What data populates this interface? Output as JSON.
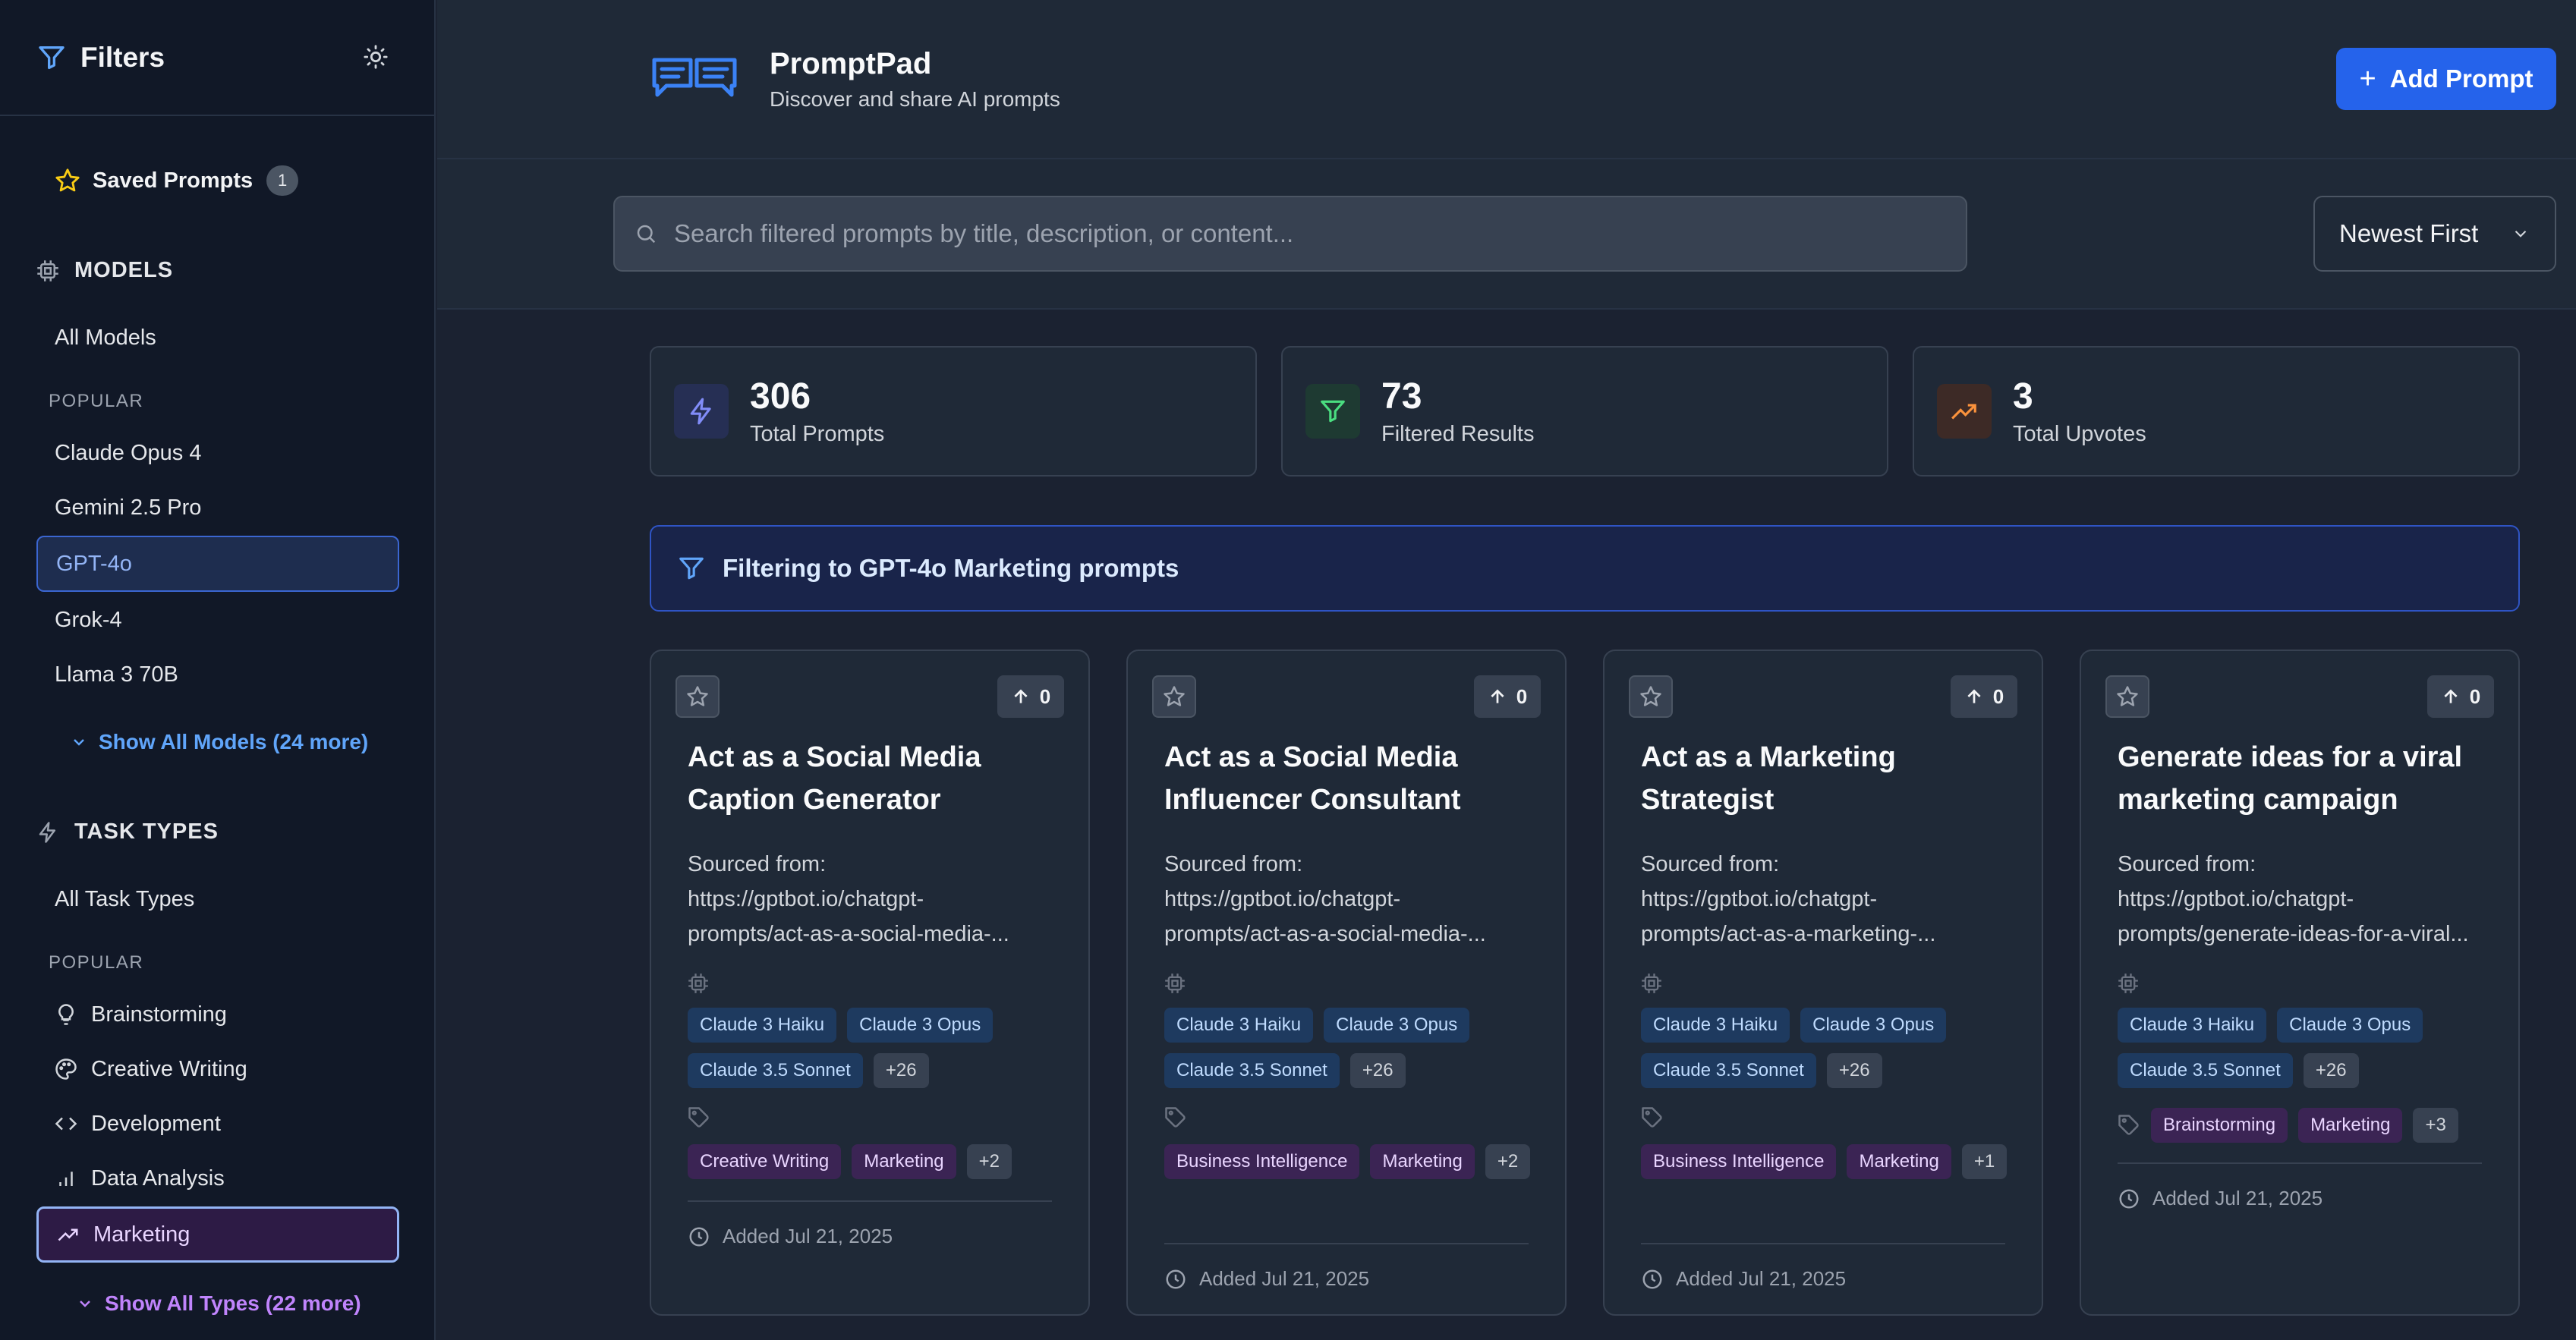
{
  "sidebar": {
    "title": "Filters",
    "saved_label": "Saved Prompts",
    "saved_count": "1",
    "models": {
      "title": "MODELS",
      "all": "All Models",
      "popular_label": "POPULAR",
      "items": [
        "Claude Opus 4",
        "Gemini 2.5 Pro",
        "GPT-4o",
        "Grok-4",
        "Llama 3 70B"
      ],
      "show_more": "Show All Models (24 more)"
    },
    "task_types": {
      "title": "TASK TYPES",
      "all": "All Task Types",
      "popular_label": "POPULAR",
      "items": [
        "Brainstorming",
        "Creative Writing",
        "Development",
        "Data Analysis",
        "Marketing"
      ],
      "show_more": "Show All Types (22 more)"
    }
  },
  "header": {
    "app_name": "PromptPad",
    "tagline": "Discover and share AI prompts",
    "add_label": "Add Prompt"
  },
  "search": {
    "placeholder": "Search filtered prompts by title, description, or content...",
    "sort_value": "Newest First"
  },
  "stats": [
    {
      "value": "306",
      "label": "Total Prompts"
    },
    {
      "value": "73",
      "label": "Filtered Results"
    },
    {
      "value": "3",
      "label": "Total Upvotes"
    }
  ],
  "filter_banner": "Filtering to GPT-4o Marketing prompts",
  "cards": [
    {
      "votes": "0",
      "title": "Act as a Social Media Caption Generator",
      "desc_line1": "Sourced from:",
      "desc_line2": "https://gptbot.io/chatgpt-",
      "desc_line3": "prompts/act-as-a-social-media-...",
      "models": [
        "Claude 3 Haiku",
        "Claude 3 Opus",
        "Claude 3.5 Sonnet"
      ],
      "models_more": "+26",
      "tags": [
        "Creative Writing",
        "Marketing"
      ],
      "tags_more": "+2",
      "added": "Added Jul 21, 2025"
    },
    {
      "votes": "0",
      "title": "Act as a Social Media Influencer Consultant",
      "desc_line1": "Sourced from:",
      "desc_line2": "https://gptbot.io/chatgpt-",
      "desc_line3": "prompts/act-as-a-social-media-...",
      "models": [
        "Claude 3 Haiku",
        "Claude 3 Opus",
        "Claude 3.5 Sonnet"
      ],
      "models_more": "+26",
      "tags": [
        "Business Intelligence",
        "Marketing"
      ],
      "tags_more": "+2",
      "added": "Added Jul 21, 2025"
    },
    {
      "votes": "0",
      "title": "Act as a Marketing Strategist",
      "desc_line1": "Sourced from:",
      "desc_line2": "https://gptbot.io/chatgpt-",
      "desc_line3": "prompts/act-as-a-marketing-...",
      "models": [
        "Claude 3 Haiku",
        "Claude 3 Opus",
        "Claude 3.5 Sonnet"
      ],
      "models_more": "+26",
      "tags": [
        "Business Intelligence",
        "Marketing"
      ],
      "tags_more": "+1",
      "added": "Added Jul 21, 2025"
    },
    {
      "votes": "0",
      "title": "Generate ideas for a viral marketing campaign",
      "desc_line1": "Sourced from:",
      "desc_line2": "https://gptbot.io/chatgpt-",
      "desc_line3": "prompts/generate-ideas-for-a-viral...",
      "models": [
        "Claude 3 Haiku",
        "Claude 3 Opus",
        "Claude 3.5 Sonnet"
      ],
      "models_more": "+26",
      "tags": [
        "Brainstorming",
        "Marketing"
      ],
      "tags_more": "+3",
      "added": "Added Jul 21, 2025"
    }
  ],
  "colors": {
    "accent": "#2563eb",
    "active_model": "#3b66d1",
    "active_type": "#93b4f5",
    "show_models": "#60a5fa",
    "show_types": "#c084fc"
  }
}
